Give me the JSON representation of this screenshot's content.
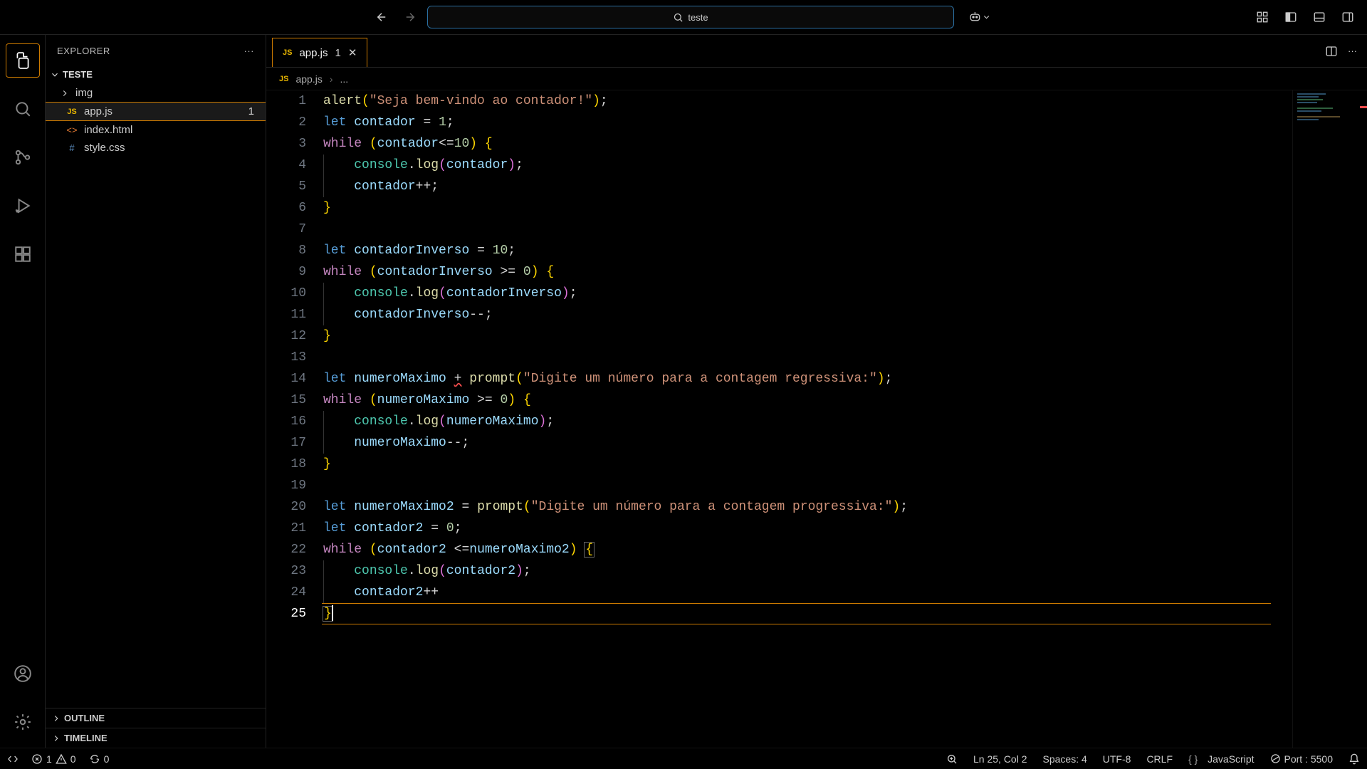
{
  "titlebar": {
    "search_text": "teste"
  },
  "sidebar": {
    "title": "EXPLORER",
    "project": "TESTE",
    "files": [
      {
        "name": "img",
        "type": "folder"
      },
      {
        "name": "app.js",
        "type": "js",
        "badge": "1",
        "selected": true
      },
      {
        "name": "index.html",
        "type": "html"
      },
      {
        "name": "style.css",
        "type": "css"
      }
    ],
    "outline": "OUTLINE",
    "timeline": "TIMELINE"
  },
  "tab": {
    "filename": "app.js",
    "problem_count": "1"
  },
  "breadcrumb": {
    "file": "app.js",
    "tail": "..."
  },
  "code": {
    "lines": [
      [
        {
          "c": "tk-fn",
          "t": "alert"
        },
        {
          "c": "tk-brkt",
          "t": "("
        },
        {
          "c": "tk-str",
          "t": "\"Seja bem-vindo ao contador!\""
        },
        {
          "c": "tk-brkt",
          "t": ")"
        },
        {
          "c": "tk-pun",
          "t": ";"
        }
      ],
      [
        {
          "c": "tk-decl",
          "t": "let"
        },
        {
          "c": "",
          "t": " "
        },
        {
          "c": "tk-var",
          "t": "contador"
        },
        {
          "c": "",
          "t": " "
        },
        {
          "c": "tk-pun",
          "t": "="
        },
        {
          "c": "",
          "t": " "
        },
        {
          "c": "tk-num",
          "t": "1"
        },
        {
          "c": "tk-pun",
          "t": ";"
        }
      ],
      [
        {
          "c": "tk-kw",
          "t": "while"
        },
        {
          "c": "",
          "t": " "
        },
        {
          "c": "tk-brkt",
          "t": "("
        },
        {
          "c": "tk-var",
          "t": "contador"
        },
        {
          "c": "tk-pun",
          "t": "<="
        },
        {
          "c": "tk-num",
          "t": "10"
        },
        {
          "c": "tk-brkt",
          "t": ")"
        },
        {
          "c": "",
          "t": " "
        },
        {
          "c": "tk-brkt",
          "t": "{"
        }
      ],
      [
        {
          "c": "",
          "t": "    ",
          "g": true
        },
        {
          "c": "tk-obj",
          "t": "console"
        },
        {
          "c": "tk-pun",
          "t": "."
        },
        {
          "c": "tk-fn",
          "t": "log"
        },
        {
          "c": "tk-brkm",
          "t": "("
        },
        {
          "c": "tk-var",
          "t": "contador"
        },
        {
          "c": "tk-brkm",
          "t": ")"
        },
        {
          "c": "tk-pun",
          "t": ";"
        }
      ],
      [
        {
          "c": "",
          "t": "    ",
          "g": true
        },
        {
          "c": "tk-var",
          "t": "contador"
        },
        {
          "c": "tk-pun",
          "t": "++;"
        }
      ],
      [
        {
          "c": "tk-brkt",
          "t": "}"
        }
      ],
      [],
      [
        {
          "c": "tk-decl",
          "t": "let"
        },
        {
          "c": "",
          "t": " "
        },
        {
          "c": "tk-var",
          "t": "contadorInverso"
        },
        {
          "c": "",
          "t": " "
        },
        {
          "c": "tk-pun",
          "t": "="
        },
        {
          "c": "",
          "t": " "
        },
        {
          "c": "tk-num",
          "t": "10"
        },
        {
          "c": "tk-pun",
          "t": ";"
        }
      ],
      [
        {
          "c": "tk-kw",
          "t": "while"
        },
        {
          "c": "",
          "t": " "
        },
        {
          "c": "tk-brkt",
          "t": "("
        },
        {
          "c": "tk-var",
          "t": "contadorInverso"
        },
        {
          "c": "",
          "t": " "
        },
        {
          "c": "tk-pun",
          "t": ">="
        },
        {
          "c": "",
          "t": " "
        },
        {
          "c": "tk-num",
          "t": "0"
        },
        {
          "c": "tk-brkt",
          "t": ")"
        },
        {
          "c": "",
          "t": " "
        },
        {
          "c": "tk-brkt",
          "t": "{"
        }
      ],
      [
        {
          "c": "",
          "t": "    ",
          "g": true
        },
        {
          "c": "tk-obj",
          "t": "console"
        },
        {
          "c": "tk-pun",
          "t": "."
        },
        {
          "c": "tk-fn",
          "t": "log"
        },
        {
          "c": "tk-brkm",
          "t": "("
        },
        {
          "c": "tk-var",
          "t": "contadorInverso"
        },
        {
          "c": "tk-brkm",
          "t": ")"
        },
        {
          "c": "tk-pun",
          "t": ";"
        }
      ],
      [
        {
          "c": "",
          "t": "    ",
          "g": true
        },
        {
          "c": "tk-var",
          "t": "contadorInverso"
        },
        {
          "c": "tk-pun",
          "t": "--;"
        }
      ],
      [
        {
          "c": "tk-brkt",
          "t": "}"
        }
      ],
      [],
      [
        {
          "c": "tk-decl",
          "t": "let"
        },
        {
          "c": "",
          "t": " "
        },
        {
          "c": "tk-var",
          "t": "numeroMaximo"
        },
        {
          "c": "",
          "t": " "
        },
        {
          "c": "tk-pun squiggle",
          "t": "+"
        },
        {
          "c": "",
          "t": " "
        },
        {
          "c": "tk-fn",
          "t": "prompt"
        },
        {
          "c": "tk-brkt",
          "t": "("
        },
        {
          "c": "tk-str",
          "t": "\"Digite um número para a contagem regressiva:\""
        },
        {
          "c": "tk-brkt",
          "t": ")"
        },
        {
          "c": "tk-pun",
          "t": ";"
        }
      ],
      [
        {
          "c": "tk-kw",
          "t": "while"
        },
        {
          "c": "",
          "t": " "
        },
        {
          "c": "tk-brkt",
          "t": "("
        },
        {
          "c": "tk-var",
          "t": "numeroMaximo"
        },
        {
          "c": "",
          "t": " "
        },
        {
          "c": "tk-pun",
          "t": ">="
        },
        {
          "c": "",
          "t": " "
        },
        {
          "c": "tk-num",
          "t": "0"
        },
        {
          "c": "tk-brkt",
          "t": ")"
        },
        {
          "c": "",
          "t": " "
        },
        {
          "c": "tk-brkt",
          "t": "{"
        }
      ],
      [
        {
          "c": "",
          "t": "    ",
          "g": true
        },
        {
          "c": "tk-obj",
          "t": "console"
        },
        {
          "c": "tk-pun",
          "t": "."
        },
        {
          "c": "tk-fn",
          "t": "log"
        },
        {
          "c": "tk-brkm",
          "t": "("
        },
        {
          "c": "tk-var",
          "t": "numeroMaximo"
        },
        {
          "c": "tk-brkm",
          "t": ")"
        },
        {
          "c": "tk-pun",
          "t": ";"
        }
      ],
      [
        {
          "c": "",
          "t": "    ",
          "g": true
        },
        {
          "c": "tk-var",
          "t": "numeroMaximo"
        },
        {
          "c": "tk-pun",
          "t": "--;"
        }
      ],
      [
        {
          "c": "tk-brkt",
          "t": "}"
        }
      ],
      [],
      [
        {
          "c": "tk-decl",
          "t": "let"
        },
        {
          "c": "",
          "t": " "
        },
        {
          "c": "tk-var",
          "t": "numeroMaximo2"
        },
        {
          "c": "",
          "t": " "
        },
        {
          "c": "tk-pun",
          "t": "="
        },
        {
          "c": "",
          "t": " "
        },
        {
          "c": "tk-fn",
          "t": "prompt"
        },
        {
          "c": "tk-brkt",
          "t": "("
        },
        {
          "c": "tk-str",
          "t": "\"Digite um número para a contagem progressiva:\""
        },
        {
          "c": "tk-brkt",
          "t": ")"
        },
        {
          "c": "tk-pun",
          "t": ";"
        }
      ],
      [
        {
          "c": "tk-decl",
          "t": "let"
        },
        {
          "c": "",
          "t": " "
        },
        {
          "c": "tk-var",
          "t": "contador2"
        },
        {
          "c": "",
          "t": " "
        },
        {
          "c": "tk-pun",
          "t": "="
        },
        {
          "c": "",
          "t": " "
        },
        {
          "c": "tk-num",
          "t": "0"
        },
        {
          "c": "tk-pun",
          "t": ";"
        }
      ],
      [
        {
          "c": "tk-kw",
          "t": "while"
        },
        {
          "c": "",
          "t": " "
        },
        {
          "c": "tk-brkt",
          "t": "("
        },
        {
          "c": "tk-var",
          "t": "contador2"
        },
        {
          "c": "",
          "t": " "
        },
        {
          "c": "tk-pun",
          "t": "<="
        },
        {
          "c": "tk-var",
          "t": "numeroMaximo2"
        },
        {
          "c": "tk-brkt",
          "t": ")"
        },
        {
          "c": "",
          "t": " "
        },
        {
          "c": "tk-brkt tk-bmatch",
          "t": "{"
        }
      ],
      [
        {
          "c": "",
          "t": "    ",
          "g": true
        },
        {
          "c": "tk-obj",
          "t": "console"
        },
        {
          "c": "tk-pun",
          "t": "."
        },
        {
          "c": "tk-fn",
          "t": "log"
        },
        {
          "c": "tk-brkm",
          "t": "("
        },
        {
          "c": "tk-var",
          "t": "contador2"
        },
        {
          "c": "tk-brkm",
          "t": ")"
        },
        {
          "c": "tk-pun",
          "t": ";"
        }
      ],
      [
        {
          "c": "",
          "t": "    ",
          "g": true
        },
        {
          "c": "tk-var",
          "t": "contador2"
        },
        {
          "c": "tk-pun",
          "t": "++"
        }
      ],
      [
        {
          "c": "tk-brkt tk-bmatch",
          "t": "}"
        },
        {
          "cursor": true
        }
      ]
    ],
    "current_line": 25
  },
  "status": {
    "errors": "1",
    "warnings": "0",
    "ports": "0",
    "position": "Ln 25, Col 2",
    "spaces": "Spaces: 4",
    "encoding": "UTF-8",
    "eol": "CRLF",
    "language": "JavaScript",
    "liveserver": "Port : 5500"
  }
}
